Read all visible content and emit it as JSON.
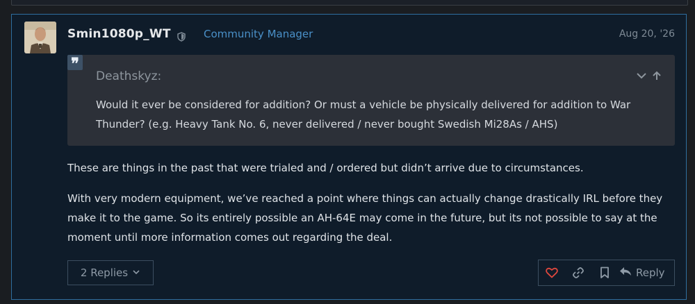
{
  "post": {
    "username": "Smin1080p_WT",
    "role": "Community Manager",
    "date": "Aug 20, '26",
    "quote": {
      "mark": "❞",
      "author": "Deathskyz:",
      "text": "Would it ever be considered for addition? Or must a vehicle be physically delivered for addition to War Thunder? (e.g. Heavy Tank No. 6, never delivered / never bought Swedish Mi28As / AHS)"
    },
    "paragraphs": [
      "These are things in the past that were trialed and / ordered but didn’t arrive due to circumstances.",
      "With very modern equipment, we’ve reached a point where things can actually change drastically IRL before they make it to the game. So its entirely possible an AH-64E may come in the future, but its not possible to say at the moment until more information comes out regarding the deal."
    ],
    "replies_label": "2 Replies",
    "reply_label": "Reply"
  },
  "icons": {
    "shield": "shield-icon",
    "expand": "chevron-down-icon",
    "jump": "arrow-up-icon",
    "like": "heart-icon",
    "link": "link-icon",
    "bookmark": "bookmark-icon",
    "reply": "reply-arrow-icon"
  },
  "colors": {
    "accent": "#4a90c8",
    "like": "#e0483e",
    "post_border": "#2f6fa0"
  }
}
